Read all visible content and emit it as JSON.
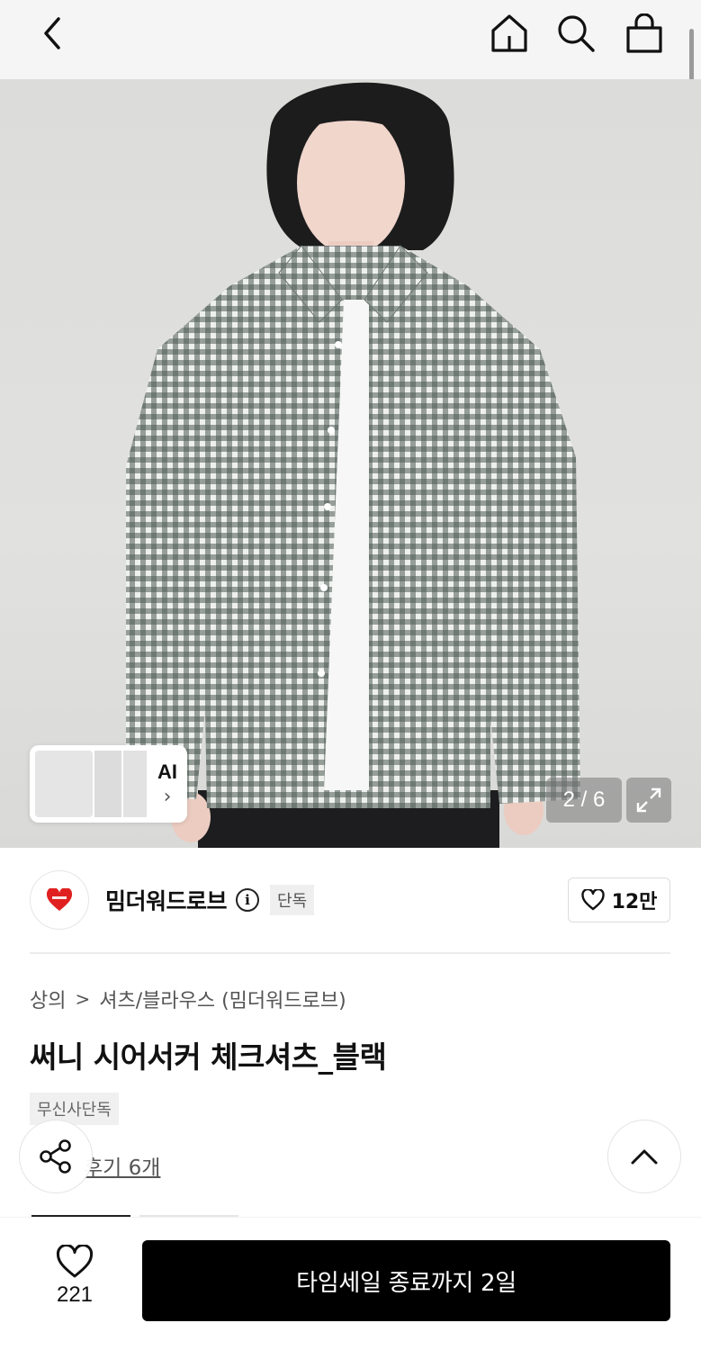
{
  "header": {
    "back_icon": "chevron-left-icon",
    "home_icon": "home-icon",
    "search_icon": "search-icon",
    "cart_icon": "shopping-bag-icon"
  },
  "gallery": {
    "ai_label": "AI",
    "ai_arrow": "›",
    "counter": "2 / 6",
    "expand_icon": "expand-icon"
  },
  "brand": {
    "name": "밈더워드로브",
    "badge": "단독",
    "likes": "12만",
    "logo_color": "#e02020"
  },
  "product": {
    "breadcrumb": [
      "상의",
      "셔츠/블라우스 (밈더워드로브)"
    ],
    "breadcrumb_separator": ">",
    "title": "써니 시어서커 체크셔츠_블랙",
    "exclusive_tag": "무신사단독",
    "review_link": "후기 6개"
  },
  "bottom_bar": {
    "wish_count": "221",
    "cta_label": "타임세일 종료까지 2일"
  },
  "colors": {
    "cta_background": "#000000",
    "header_background": "#f5f5f5"
  }
}
